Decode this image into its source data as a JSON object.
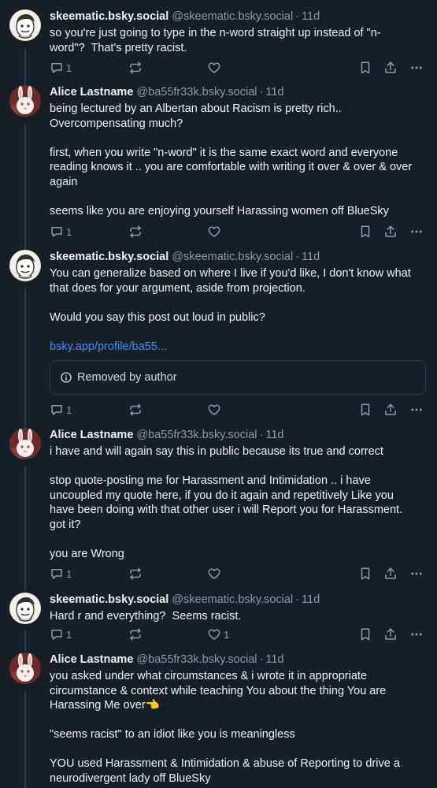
{
  "posts": [
    {
      "display_name": "skeematic.bsky.social",
      "handle": "@skeematic.bsky.social",
      "time": "11d",
      "lines": [
        "so you're just going to type in the n-word straight up instead of \"n-",
        "word\"?  That's pretty racist."
      ],
      "reply_count": "1",
      "like_count": ""
    },
    {
      "display_name": "Alice Lastname",
      "handle": "@ba55fr33k.bsky.social",
      "time": "11d",
      "lines": [
        "being lectured by an Albertan about Racism is pretty rich..",
        "Overcompensating much?",
        "",
        "first, when you write \"n-word\" it is the same exact word and everyone",
        "reading knows it .. you are comfortable with writing it over & over & over",
        "again",
        "",
        "seems like you are enjoying yourself Harassing women off BlueSky"
      ],
      "reply_count": "1",
      "like_count": ""
    },
    {
      "display_name": "skeematic.bsky.social",
      "handle": "@skeematic.bsky.social",
      "time": "11d",
      "lines": [
        "You can generalize based on where I live if you'd like, I don't know what",
        "that does for your argument, aside from projection.",
        "",
        "Would you say this post out loud in public?",
        ""
      ],
      "link": "bsky.app/profile/ba55...",
      "removed": "Removed by author",
      "reply_count": "1",
      "like_count": ""
    },
    {
      "display_name": "Alice Lastname",
      "handle": "@ba55fr33k.bsky.social",
      "time": "11d",
      "lines": [
        "i have and will again say this in public because its true and correct",
        "",
        "stop quote-posting me for Harassment and Intimidation .. i have",
        "uncoupled my quote here, if you do it again and repetitively Like you",
        "have been doing with that other user i will Report you for Harassment.",
        "got it?",
        "",
        "you are Wrong"
      ],
      "reply_count": "1",
      "like_count": ""
    },
    {
      "display_name": "skeematic.bsky.social",
      "handle": "@skeematic.bsky.social",
      "time": "11d",
      "lines": [
        "Hard r and everything?  Seems racist."
      ],
      "reply_count": "1",
      "like_count": "1"
    },
    {
      "display_name": "Alice Lastname",
      "handle": "@ba55fr33k.bsky.social",
      "time": "11d",
      "lines": [
        "you asked under what circumstances & i wrote it in appropriate",
        "circumstance & context while teaching You about the thing You are",
        "Harassing Me over👈",
        "",
        "\"seems racist\" to an idiot like you is meaningless",
        "",
        "YOU used Harassment & Intimidation & abuse of Reporting to drive a",
        "neurodivergent lady off BlueSky"
      ],
      "reply_count": "",
      "like_count": ""
    }
  ],
  "separator": "·",
  "icons": {
    "reply": "reply-bubble-icon",
    "repost": "repost-arrows-icon",
    "like": "heart-icon",
    "bookmark": "bookmark-icon",
    "share": "share-icon",
    "more": "more-dots-icon",
    "info": "info-circle-icon"
  },
  "colors": {
    "background": "#161e27",
    "text": "#f1f3f5",
    "muted": "#8d9aab",
    "link": "#3c8df5"
  }
}
